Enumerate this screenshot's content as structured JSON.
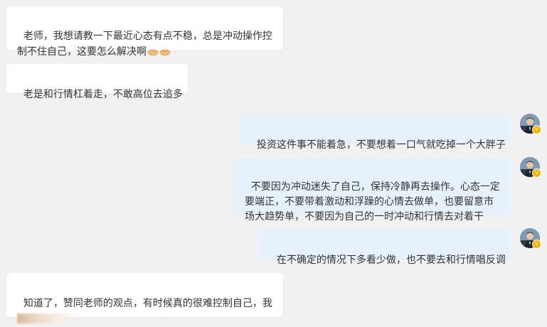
{
  "messages": [
    {
      "side": "left",
      "text": "老师，我想请教一下最近心态有点不稳，总是冲动操作控\n制不住自己，这要怎么解决啊",
      "emoji": [
        "handshake-emoji",
        "handshake-emoji"
      ]
    },
    {
      "side": "left",
      "text": "老是和行情杠着走，不敢高位去追多"
    },
    {
      "side": "right",
      "text": "投资这件事不能着急，不要想着一口气就吃掉一个大胖子",
      "avatar": "teacher-avatar",
      "badge": "verified-v-badge"
    },
    {
      "side": "right",
      "text": "不要因为冲动迷失了自己，保持冷静再去操作。心态一定\n要端正，不要带着激动和浮躁的心情去做单，也要留意市\n场大趋势单，不要因为自己的一时冲动和行情去对着干",
      "avatar": "teacher-avatar",
      "badge": "verified-v-badge"
    },
    {
      "side": "right",
      "text": "在不确定的情况下多看少做，也不要去和行情唱反调",
      "avatar": "teacher-avatar",
      "badge": "verified-v-badge"
    },
    {
      "side": "left",
      "text": "知道了，赞同老师的观点，有时候真的很难控制自己，我",
      "redacted": "blurred-text"
    }
  ],
  "colors": {
    "background": "#f1f1f1",
    "incoming_bubble": "#ffffff",
    "outgoing_bubble": "#e6f1fb",
    "badge": "#f6b400"
  }
}
